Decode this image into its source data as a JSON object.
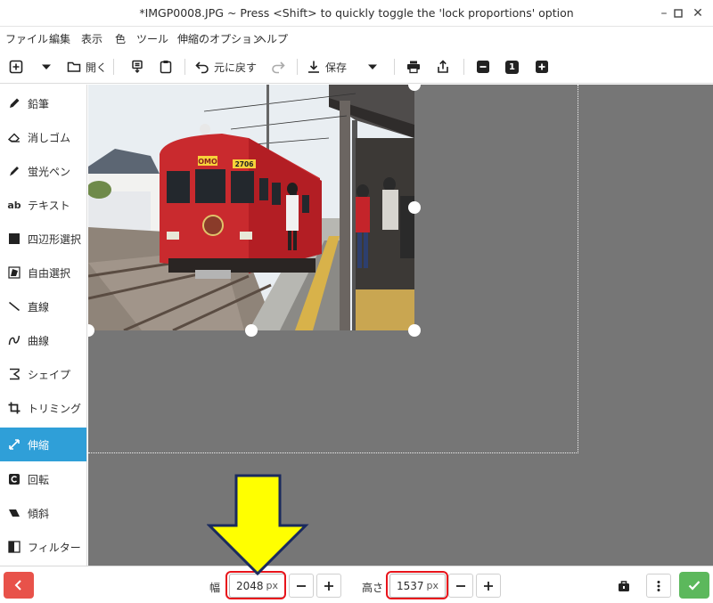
{
  "window": {
    "title": "*IMGP0008.JPG ~ Press <Shift> to quickly toggle the 'lock proportions' option",
    "minimize_icon": "minimize-icon",
    "maximize_icon": "maximize-icon",
    "close_icon": "close-icon"
  },
  "menu": [
    "ファイル",
    "編集",
    "表示",
    "色",
    "ツール",
    "伸縮のオプション",
    "ヘルプ"
  ],
  "toolbar": {
    "open_label": "開く",
    "undo_label": "元に戻す",
    "save_label": "保存",
    "zoom_value": "1"
  },
  "tools": [
    {
      "label": "鉛筆",
      "icon": "pencil-icon"
    },
    {
      "label": "消しゴム",
      "icon": "eraser-icon"
    },
    {
      "label": "蛍光ペン",
      "icon": "highlighter-icon"
    },
    {
      "label": "テキスト",
      "icon": "text-icon"
    },
    {
      "label": "四辺形選択",
      "icon": "rect-select-icon"
    },
    {
      "label": "自由選択",
      "icon": "free-select-icon"
    },
    {
      "label": "直線",
      "icon": "line-icon"
    },
    {
      "label": "曲線",
      "icon": "curve-icon"
    },
    {
      "label": "シェイプ",
      "icon": "shape-icon"
    },
    {
      "label": "トリミング",
      "icon": "crop-icon"
    },
    {
      "label": "伸縮",
      "icon": "scale-icon",
      "active": true
    },
    {
      "label": "回転",
      "icon": "rotate-icon"
    },
    {
      "label": "傾斜",
      "icon": "skew-icon"
    },
    {
      "label": "フィルター",
      "icon": "filter-icon"
    }
  ],
  "bottom": {
    "width_label": "幅",
    "width_value": "2048",
    "width_unit": "px",
    "height_label": "高さ",
    "height_value": "1537",
    "height_unit": "px"
  },
  "photo": {
    "sign_omo": "OMO",
    "car_number": "2706"
  },
  "colors": {
    "accent": "#2f9fd8",
    "cancel": "#e8524a",
    "apply": "#5cb85c",
    "highlight_box": "#e8141b",
    "arrow_fill": "#ffff00",
    "canvas_bg": "#767676"
  }
}
